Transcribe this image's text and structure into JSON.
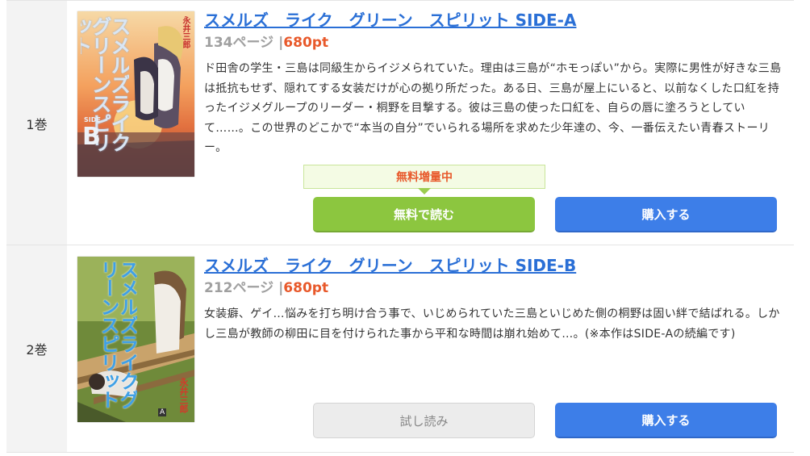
{
  "volumes": [
    {
      "volume_label": "1巻",
      "title": "スメルズ　ライク　グリーン　スピリット SIDE-A",
      "pages": "134ページ",
      "separator": "|",
      "price": "680pt",
      "description": "ド田舎の学生・三島は同級生からイジメられていた。理由は三島が“ホモっぽい”から。実際に男性が好きな三島は抵抗もせず、隠れてする女装だけが心の拠り所だった。ある日、三島が屋上にいると、以前なくした口紅を持ったイジメグループのリーダー・桐野を目撃する。彼は三島の使った口紅を、自らの唇に塗ろうとしていて……。この世界のどこかで“本当の自分”でいられる場所を求めた少年達の、今、一番伝えたい青春ストーリー。",
      "promo_badge": "無料増量中",
      "primary_button": "無料で読む",
      "buy_button": "購入する",
      "cover_text": "スメルズライクグリーンスピリット",
      "cover_author": "永井三郎",
      "cover_side": "SIDE",
      "cover_letter": "B"
    },
    {
      "volume_label": "2巻",
      "title": "スメルズ　ライク　グリーン　スピリット SIDE-B",
      "pages": "212ページ",
      "separator": "|",
      "price": "680pt",
      "description": "女装癖、ゲイ…悩みを打ち明け合う事で、いじめられていた三島といじめた側の桐野は固い絆で結ばれる。しかし三島が教師の柳田に目を付けられた事から平和な時間は崩れ始めて…。(※本作はSIDE-Aの続編です)",
      "primary_button": "試し読み",
      "buy_button": "購入する",
      "cover_text": "スメルズライクグリーンスピリット",
      "cover_author": "永井三郎",
      "cover_letter": "A"
    }
  ],
  "colors": {
    "link": "#2a6fd6",
    "price": "#e8592b",
    "free_button": "#8cc63f",
    "buy_button": "#3d7ee8"
  }
}
